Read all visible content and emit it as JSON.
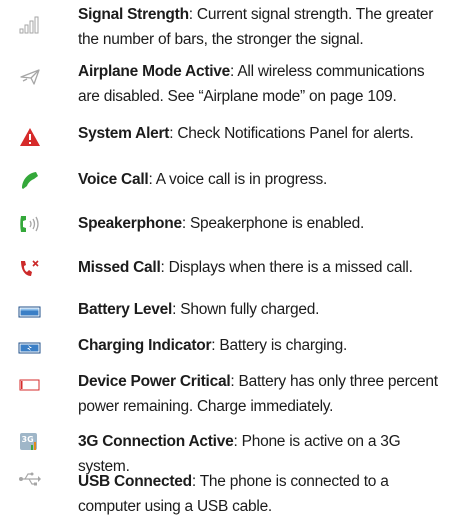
{
  "items": [
    {
      "icon": "signal-strength-icon",
      "term": "Signal Strength",
      "desc": "Current signal strength. The greater the number of bars, the stronger the signal."
    },
    {
      "icon": "airplane-icon",
      "term": "Airplane Mode Active",
      "desc": "All wireless communications are disabled. See “Airplane mode” on page 109."
    },
    {
      "icon": "system-alert-icon",
      "term": "System Alert",
      "desc": "Check Notifications Panel for alerts."
    },
    {
      "icon": "voice-call-icon",
      "term": "Voice Call",
      "desc": "A voice call is in progress."
    },
    {
      "icon": "speakerphone-icon",
      "term": "Speakerphone",
      "desc": "Speakerphone is enabled."
    },
    {
      "icon": "missed-call-icon",
      "term": "Missed Call",
      "desc": "Displays when there is a missed call."
    },
    {
      "icon": "battery-level-icon",
      "term": "Battery Level",
      "desc": "Shown fully charged."
    },
    {
      "icon": "charging-indicator-icon",
      "term": "Charging Indicator",
      "desc": "Battery is charging."
    },
    {
      "icon": "battery-critical-icon",
      "term": "Device Power Critical",
      "desc": "Battery has only three percent power remaining. Charge immediately."
    },
    {
      "icon": "3g-connection-icon",
      "term": "3G Connection Active",
      "desc": "Phone is active on a 3G system."
    },
    {
      "icon": "usb-icon",
      "term": "USB Connected",
      "desc": "The phone is connected to a computer using a USB cable."
    }
  ],
  "separator": ": ",
  "icon_labels": {
    "threeg": "3G"
  },
  "colors": {
    "alert": "#d62b2b",
    "call": "#34a83a",
    "missed": "#cc2a2a",
    "battery": "#3b7fc6",
    "critical": "#d62b2b",
    "gray": "#a6a6a6"
  }
}
